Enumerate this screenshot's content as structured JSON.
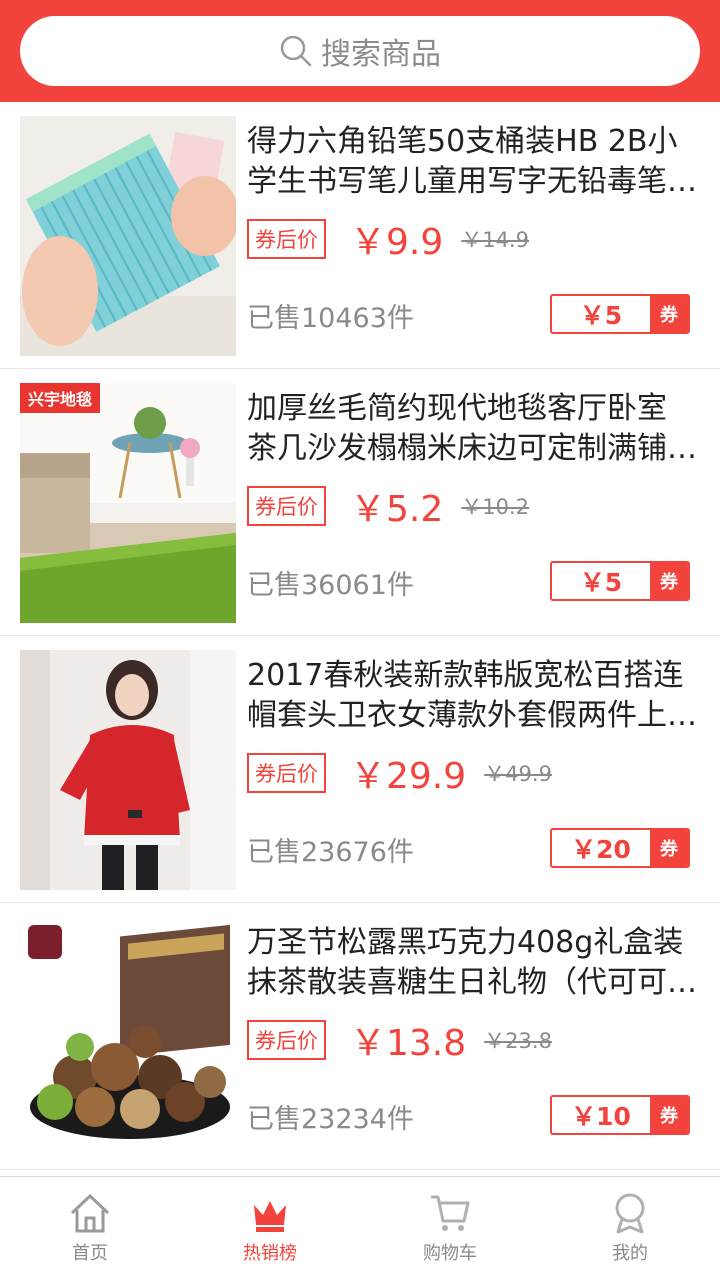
{
  "search": {
    "placeholder": "搜索商品"
  },
  "products": [
    {
      "title_line1": "得力六角铅笔50支桶装HB 2B小",
      "title_line2": "学生书写笔儿童用写字无铅毒笔…",
      "tag": "券后价",
      "price": "￥9.9",
      "original_price": "￥14.9",
      "sold": "已售10463件",
      "coupon_amount": "￥5",
      "coupon_label": "券",
      "store_tag": ""
    },
    {
      "title_line1": "加厚丝毛简约现代地毯客厅卧室",
      "title_line2": "茶几沙发榻榻米床边可定制满铺…",
      "tag": "券后价",
      "price": "￥5.2",
      "original_price": "￥10.2",
      "sold": "已售36061件",
      "coupon_amount": "￥5",
      "coupon_label": "券",
      "store_tag": "兴宇地毯"
    },
    {
      "title_line1": "2017春秋装新款韩版宽松百搭连",
      "title_line2": "帽套头卫衣女薄款外套假两件上…",
      "tag": "券后价",
      "price": "￥29.9",
      "original_price": "￥49.9",
      "sold": "已售23676件",
      "coupon_amount": "￥20",
      "coupon_label": "券",
      "store_tag": ""
    },
    {
      "title_line1": "万圣节松露黑巧克力408g礼盒装",
      "title_line2": "抹茶散装喜糖生日礼物（代可可…",
      "tag": "券后价",
      "price": "￥13.8",
      "original_price": "￥23.8",
      "sold": "已售23234件",
      "coupon_amount": "￥10",
      "coupon_label": "券",
      "store_tag": ""
    }
  ],
  "nav": [
    {
      "label": "首页",
      "icon": "home-icon",
      "active": false
    },
    {
      "label": "热销榜",
      "icon": "crown-icon",
      "active": true
    },
    {
      "label": "购物车",
      "icon": "cart-icon",
      "active": false
    },
    {
      "label": "我的",
      "icon": "user-icon",
      "active": false
    }
  ],
  "colors": {
    "accent": "#f2433c",
    "muted": "#8a8a8a"
  }
}
